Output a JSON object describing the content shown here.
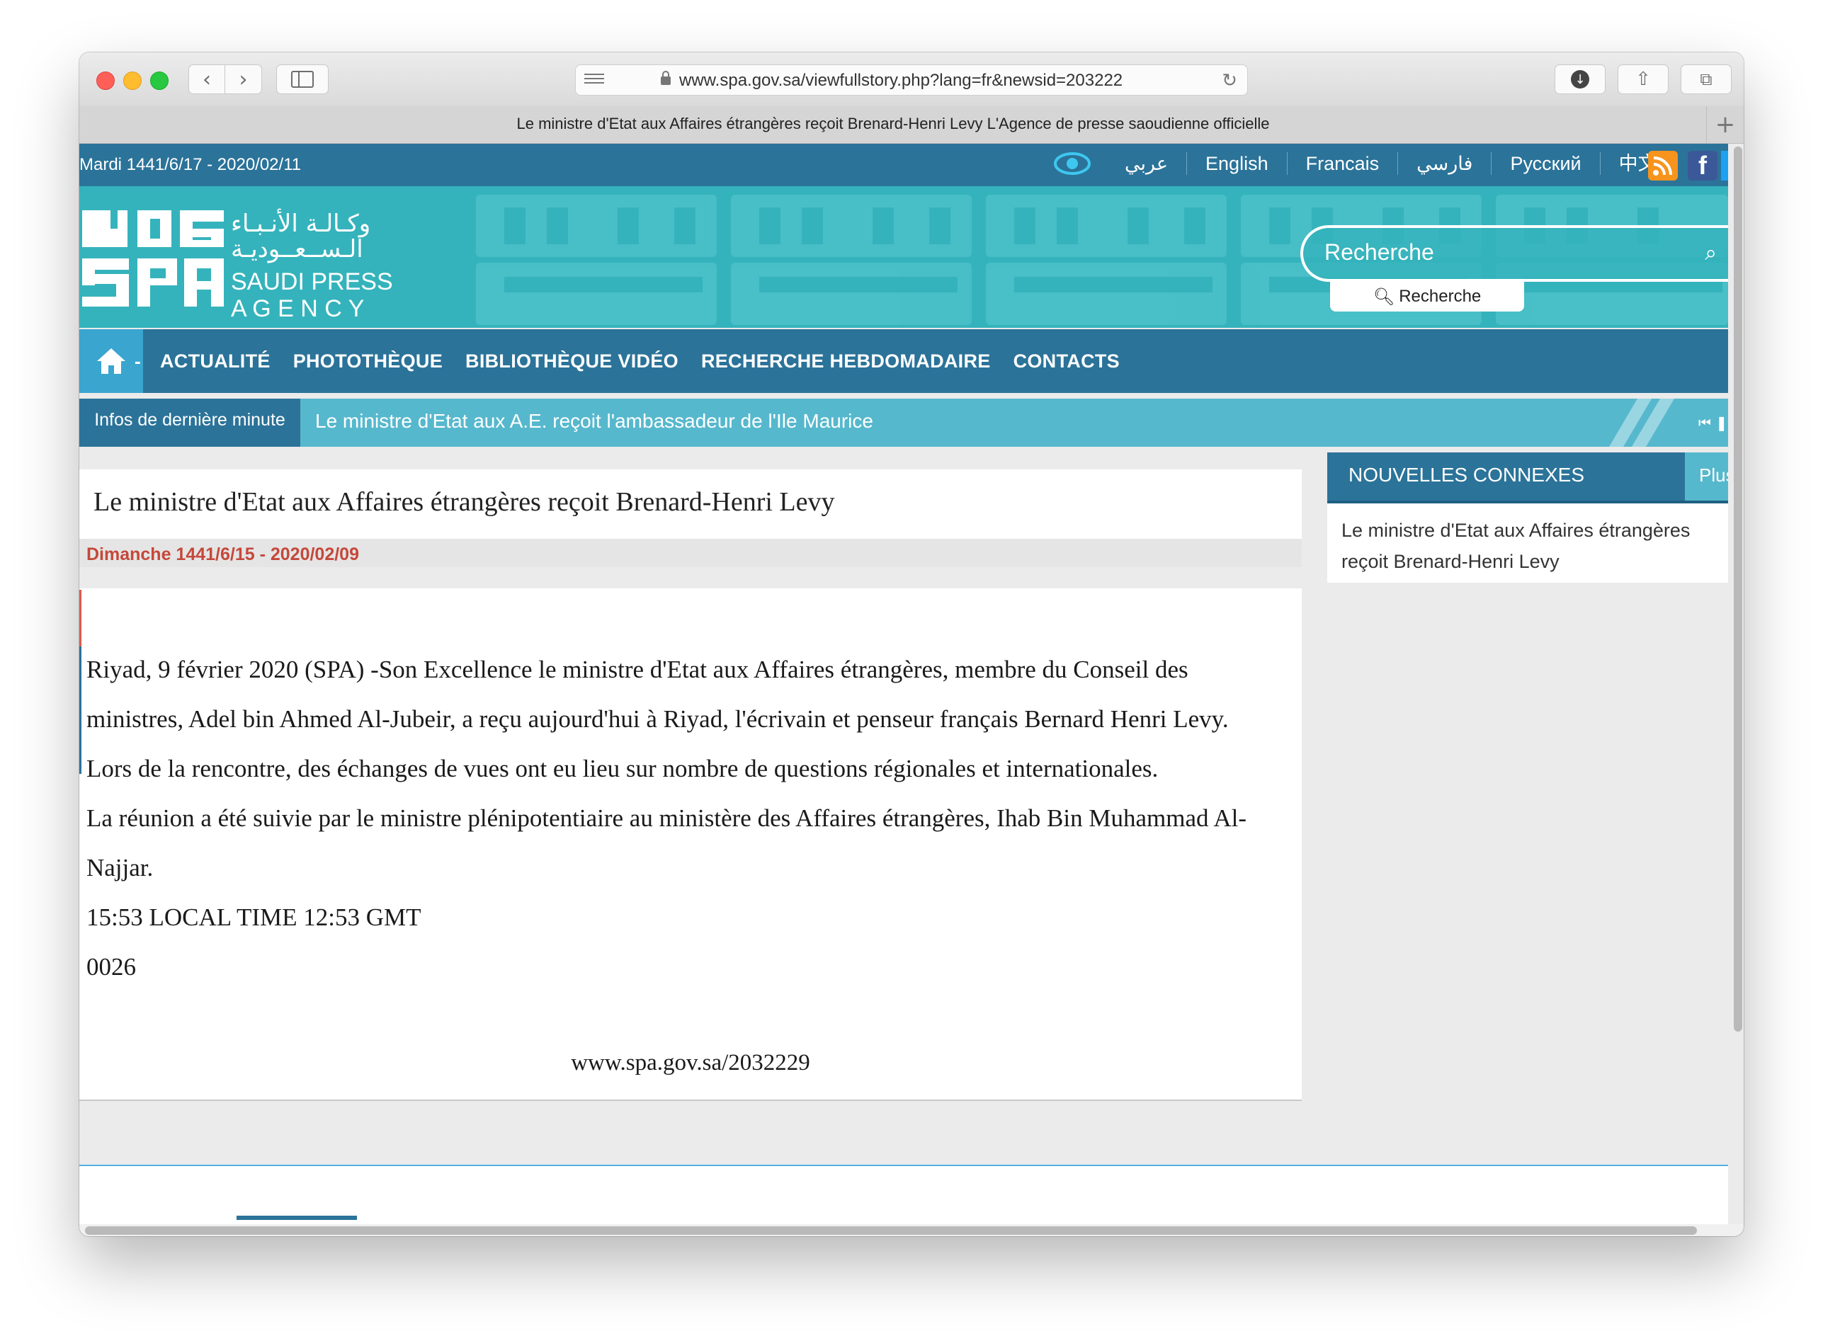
{
  "browser": {
    "url": "www.spa.gov.sa/viewfullstory.php?lang=fr&newsid=203222",
    "tab_title": "Le ministre d'Etat aux Affaires étrangères reçoit Brenard-Henri Levy L'Agence de presse saoudienne officielle",
    "new_tab": "+"
  },
  "topbar": {
    "date": "Mardi 1441/6/17 - 2020/02/11",
    "languages": [
      "عربي",
      "English",
      "Francais",
      "فارسي",
      "Русский",
      "中文"
    ],
    "fb_letter": "f"
  },
  "logo": {
    "arabic_line1": "وكـالـة الأنـبـاء",
    "arabic_line2": "الـســعــوديـة",
    "english_line1": "SAUDI PRESS",
    "english_line2": "A G E N C Y",
    "wordmark_top": "WAS",
    "wordmark_bottom": "SPA"
  },
  "search": {
    "placeholder": "Recherche",
    "button_label": "Recherche"
  },
  "nav": {
    "home_suffix": "-",
    "items": [
      "ACTUALITÉ",
      "PHOTOTHÈQUE",
      "BIBLIOTHÈQUE VIDÉO",
      "RECHERCHE HEBDOMADAIRE",
      "CONTACTS"
    ]
  },
  "ticker": {
    "label": "Infos de dernière minute",
    "headline": "Le ministre d'Etat aux A.E. reçoit l'ambassadeur de l'Ile Maurice"
  },
  "article": {
    "title": "Le ministre d'Etat aux Affaires étrangères reçoit Brenard-Henri Levy",
    "date": "Dimanche 1441/6/15 - 2020/02/09",
    "paragraphs": [
      "Riyad, 9 février 2020 (SPA) -Son Excellence le ministre d'Etat aux Affaires étrangères, membre du Conseil des ministres, Adel bin Ahmed Al-Jubeir, a reçu aujourd'hui à Riyad, l'écrivain et penseur français Bernard Henri Levy.",
      "Lors de la rencontre, des échanges de vues ont eu lieu sur nombre de questions régionales et internationales.",
      "La réunion a été suivie par le ministre plénipotentiaire au ministère des Affaires étrangères, Ihab Bin Muhammad Al-Najjar.",
      "15:53 LOCAL TIME 12:53 GMT",
      "0026"
    ],
    "short_url": "www.spa.gov.sa/2032229"
  },
  "related": {
    "title": "NOUVELLES CONNEXES",
    "more": "Plus",
    "items": [
      "Le ministre d'Etat aux Affaires étrangères reçoit Brenard-Henri Levy"
    ]
  },
  "colors": {
    "primary": "#2b7399",
    "banner": "#35b3bc",
    "accent_light": "#56b8cd",
    "date_red": "#c5483a"
  }
}
